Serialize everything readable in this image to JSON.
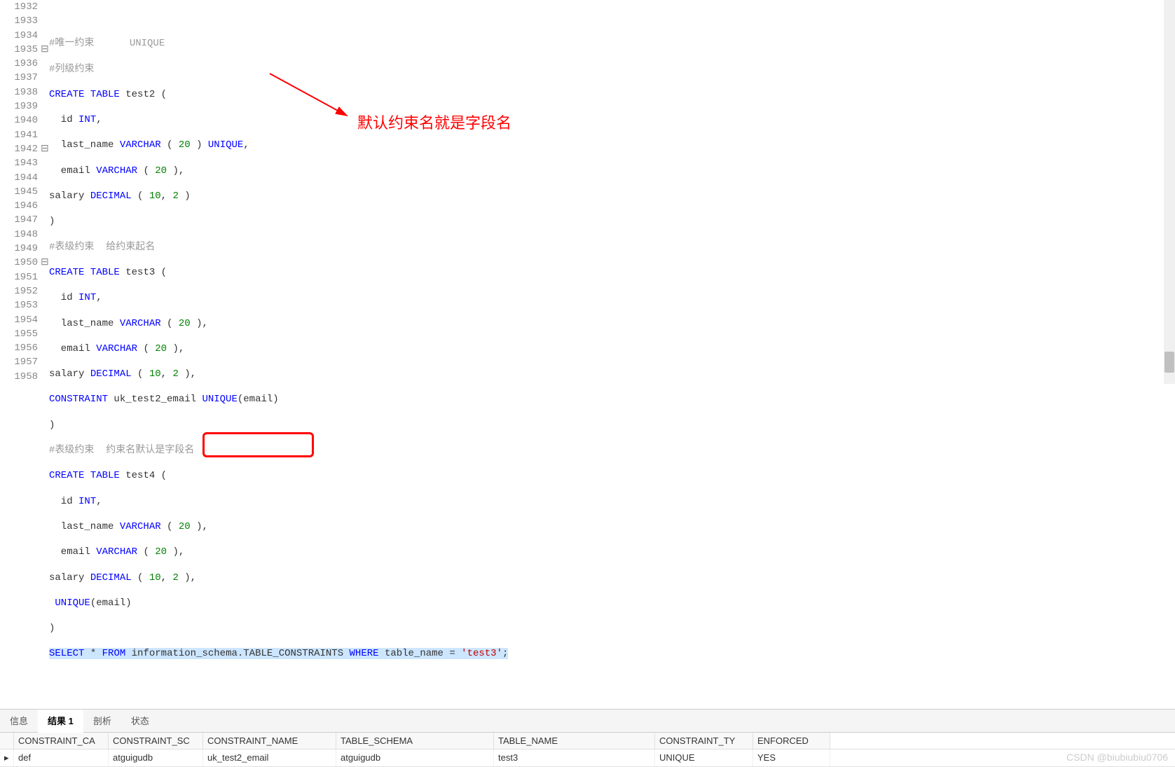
{
  "editor": {
    "lines": [
      {
        "num": "1932",
        "fold": ""
      },
      {
        "num": "1933",
        "fold": ""
      },
      {
        "num": "1934",
        "fold": ""
      },
      {
        "num": "1935",
        "fold": "⊟"
      },
      {
        "num": "1936",
        "fold": ""
      },
      {
        "num": "1937",
        "fold": ""
      },
      {
        "num": "1938",
        "fold": ""
      },
      {
        "num": "1939",
        "fold": ""
      },
      {
        "num": "1940",
        "fold": ""
      },
      {
        "num": "1941",
        "fold": ""
      },
      {
        "num": "1942",
        "fold": "⊟"
      },
      {
        "num": "1943",
        "fold": ""
      },
      {
        "num": "1944",
        "fold": ""
      },
      {
        "num": "1945",
        "fold": ""
      },
      {
        "num": "1946",
        "fold": ""
      },
      {
        "num": "1947",
        "fold": ""
      },
      {
        "num": "1948",
        "fold": ""
      },
      {
        "num": "1949",
        "fold": ""
      },
      {
        "num": "1950",
        "fold": "⊟"
      },
      {
        "num": "1951",
        "fold": ""
      },
      {
        "num": "1952",
        "fold": ""
      },
      {
        "num": "1953",
        "fold": ""
      },
      {
        "num": "1954",
        "fold": ""
      },
      {
        "num": "1955",
        "fold": ""
      },
      {
        "num": "1956",
        "fold": ""
      },
      {
        "num": "1957",
        "fold": ""
      },
      {
        "num": "1958",
        "fold": ""
      }
    ],
    "comment1_a": "#唯一约束",
    "comment1_b": "UNIQUE",
    "comment2": "#列级约束",
    "comment3": "#表级约束  给约束起名",
    "comment4": "#表级约束  约束名默认是字段名",
    "kw_create": "CREATE",
    "kw_table": "TABLE",
    "kw_int": "INT",
    "kw_varchar": "VARCHAR",
    "kw_unique": "UNIQUE",
    "kw_decimal": "DECIMAL",
    "kw_constraint": "CONSTRAINT",
    "kw_select": "SELECT",
    "kw_from": "FROM",
    "kw_where": "WHERE",
    "test2": "test2 (",
    "test3": "test3 (",
    "test4": "test4 (",
    "id_line": "  id ",
    "last_name": "  last_name ",
    "email": "  email ",
    "salary": "salary ",
    "uk_name": "uk_test2_email",
    "email_ident": "email",
    "info_schema": "information_schema.TABLE_CONSTRAINTS",
    "table_name_ident": "table_name",
    "test3_str": "'test3'",
    "n20": "20",
    "n10": "10",
    "n2": "2",
    "comma": ",",
    "oparen": "(",
    "cparen": ")",
    "cparen_c": "),",
    "star": "*",
    "eq": "=",
    "semi": ";",
    "close_only": ")"
  },
  "annotation_text": "默认约束名就是字段名",
  "tabs": {
    "info": "信息",
    "result": "结果 1",
    "profile": "剖析",
    "status": "状态"
  },
  "grid": {
    "headers": {
      "catalog": "CONSTRAINT_CA",
      "schema": "CONSTRAINT_SC",
      "name": "CONSTRAINT_NAME",
      "tschema": "TABLE_SCHEMA",
      "tname": "TABLE_NAME",
      "ctype": "CONSTRAINT_TY",
      "enforced": "ENFORCED"
    },
    "row": {
      "indicator": "▸",
      "catalog": "def",
      "schema": "atguigudb",
      "name": "uk_test2_email",
      "tschema": "atguigudb",
      "tname": "test3",
      "ctype": "UNIQUE",
      "enforced": "YES"
    }
  },
  "watermark": "CSDN @biubiubiu0706"
}
